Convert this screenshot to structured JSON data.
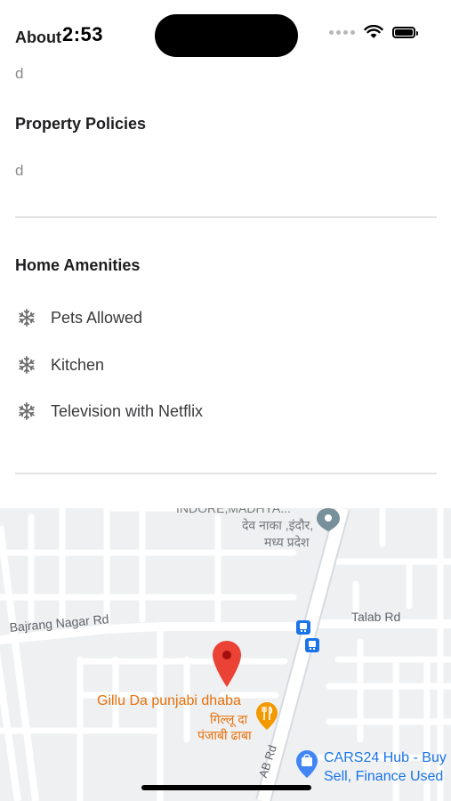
{
  "status_bar": {
    "time": "2:53"
  },
  "about": {
    "title": "About",
    "value": "d"
  },
  "property_policies": {
    "title": "Property Policies",
    "value": "d"
  },
  "home_amenities": {
    "title": "Home Amenities",
    "icon": "snowflake-icon",
    "items": [
      "Pets Allowed",
      "Kitchen",
      "Television with Netflix"
    ]
  },
  "map": {
    "labels": {
      "place_top_cut": "INDORE,MADHYA...",
      "dev_naka_hindi": "देव नाका ,इंदौर,",
      "mp_hindi": "मध्य प्रदेश",
      "bajrang_road": "Bajrang Nagar Rd",
      "talab_road": "Talab Rd",
      "gillu_en": "Gillu Da punjabi dhaba",
      "gillu_hi_1": "गिल्लू दा",
      "gillu_hi_2": "पंजाबी ढाबा",
      "ab_road": "AB Rd",
      "cars24_1": "CARS24 Hub - Buy",
      "cars24_2": "Sell, Finance Used"
    },
    "colors": {
      "pin": "#ea4335",
      "food": "#f29900",
      "label_food": "#e8710a",
      "shop": "#4285f4",
      "transit": "#1a73e8"
    }
  }
}
